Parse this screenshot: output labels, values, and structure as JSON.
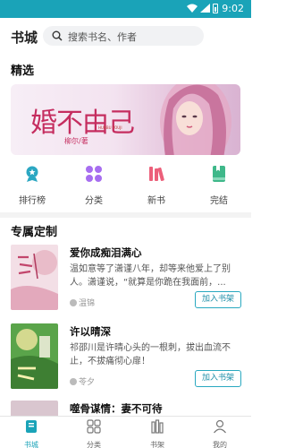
{
  "status_bar": {
    "time": "9:02"
  },
  "header": {
    "title": "书城",
    "search_placeholder": "搜索书名、作者"
  },
  "featured": {
    "section_title": "精选",
    "banner": {
      "title": "婚不由己",
      "subtitle": "HUNBU YOUJI",
      "author": "柳尔/著"
    }
  },
  "nav": [
    {
      "label": "排行榜",
      "icon": "trophy-icon",
      "color": "#2ba7c2"
    },
    {
      "label": "分类",
      "icon": "grid-icon",
      "color": "#a76ef0"
    },
    {
      "label": "新书",
      "icon": "books-icon",
      "color": "#ec5f7a"
    },
    {
      "label": "完结",
      "icon": "book-icon",
      "color": "#3fb88a"
    }
  ],
  "custom": {
    "section_title": "专属定制",
    "books": [
      {
        "title": "爱你成痴泪满心",
        "description": "温如意等了潇谨八年，却等来他爱上了别人。潇谨说，“就算是你跪在我面前，...",
        "author": "温锦",
        "button": "加入书架"
      },
      {
        "title": "许以晴深",
        "description": "祁邵川是许晴心头的一根刺，拔出血流不止，不拔痛彻心扉！",
        "author": "苓夕",
        "button": "加入书架"
      },
      {
        "title": "噬骨谋情：妻不可待",
        "description": "",
        "author": "",
        "button": ""
      }
    ]
  },
  "tabs": [
    {
      "label": "书城",
      "icon": "bookstore-icon"
    },
    {
      "label": "分类",
      "icon": "category-icon"
    },
    {
      "label": "书架",
      "icon": "bookshelf-icon"
    },
    {
      "label": "我的",
      "icon": "profile-icon"
    }
  ],
  "colors": {
    "accent": "#1aa3b8",
    "button_border": "#29a8c0"
  }
}
